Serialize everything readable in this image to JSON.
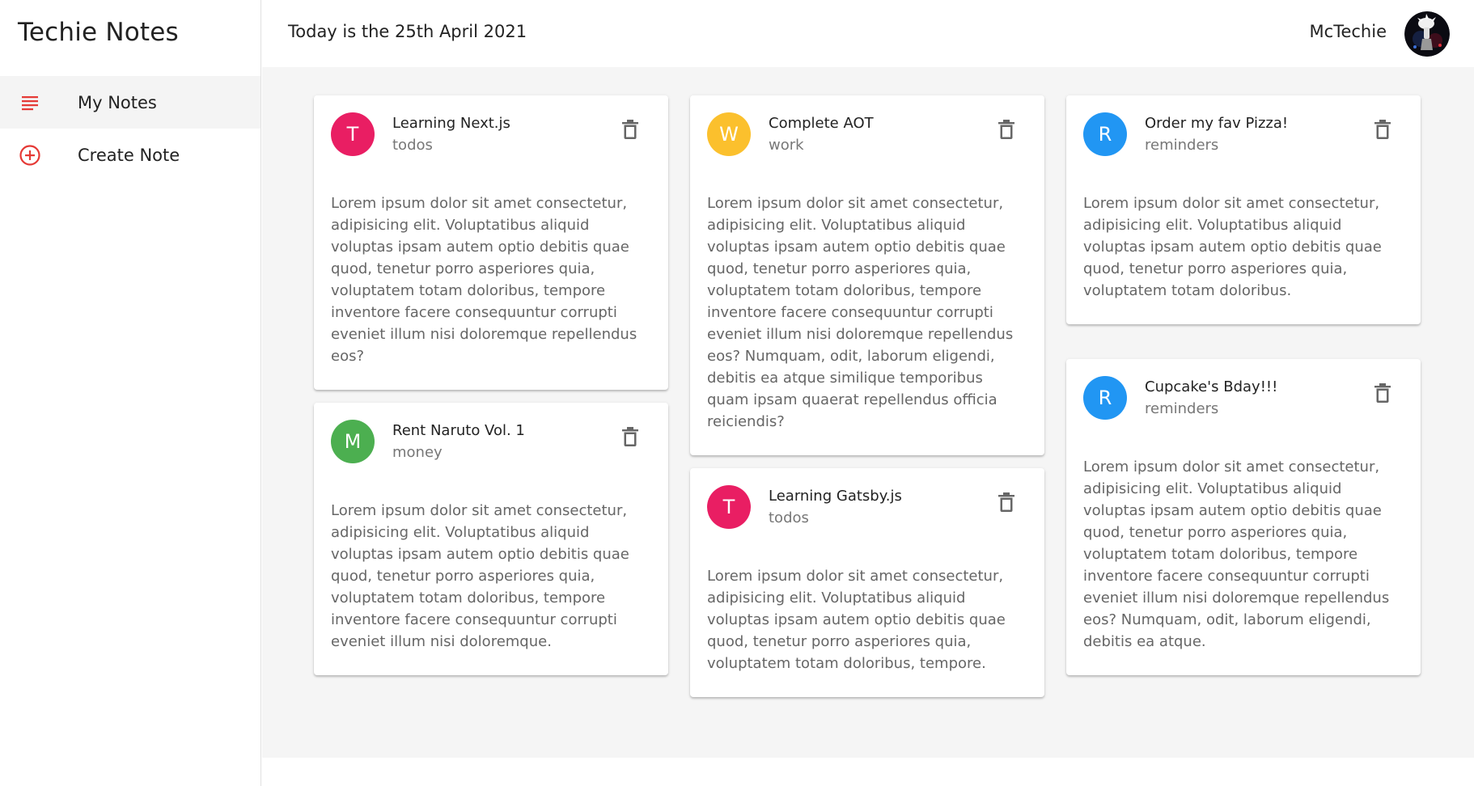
{
  "app": {
    "title": "Techie Notes"
  },
  "sidebar": {
    "items": [
      {
        "label": "My Notes",
        "icon": "subject-icon",
        "active": true
      },
      {
        "label": "Create Note",
        "icon": "add-circle-icon",
        "active": false
      }
    ]
  },
  "header": {
    "date_text": "Today is the 25th April 2021",
    "username": "McTechie"
  },
  "colors": {
    "accent": "#e53935",
    "todos": "#e91e63",
    "work": "#fbc02d",
    "money": "#4caf50",
    "reminders": "#2196f3"
  },
  "notes": [
    {
      "initial": "T",
      "title": "Learning Next.js",
      "category": "todos",
      "body": "Lorem ipsum dolor sit amet consectetur, adipisicing elit. Voluptatibus aliquid voluptas ipsam autem optio debitis quae quod, tenetur porro asperiores quia, voluptatem totam doloribus, tempore inventore facere consequuntur corrupti eveniet illum nisi doloremque repellendus eos?"
    },
    {
      "initial": "M",
      "title": "Rent Naruto Vol. 1",
      "category": "money",
      "body": "Lorem ipsum dolor sit amet consectetur, adipisicing elit. Voluptatibus aliquid voluptas ipsam autem optio debitis quae quod, tenetur porro asperiores quia, voluptatem totam doloribus, tempore inventore facere consequuntur corrupti eveniet illum nisi doloremque."
    },
    {
      "initial": "W",
      "title": "Complete AOT",
      "category": "work",
      "body": "Lorem ipsum dolor sit amet consectetur, adipisicing elit. Voluptatibus aliquid voluptas ipsam autem optio debitis quae quod, tenetur porro asperiores quia, voluptatem totam doloribus, tempore inventore facere consequuntur corrupti eveniet illum nisi doloremque repellendus eos? Numquam, odit, laborum eligendi, debitis ea atque similique temporibus quam ipsam quaerat repellendus officia reiciendis?"
    },
    {
      "initial": "T",
      "title": "Learning Gatsby.js",
      "category": "todos",
      "body": "Lorem ipsum dolor sit amet consectetur, adipisicing elit. Voluptatibus aliquid voluptas ipsam autem optio debitis quae quod, tenetur porro asperiores quia, voluptatem totam doloribus, tempore."
    },
    {
      "initial": "R",
      "title": "Order my fav Pizza!",
      "category": "reminders",
      "body": "Lorem ipsum dolor sit amet consectetur, adipisicing elit. Voluptatibus aliquid voluptas ipsam autem optio debitis quae quod, tenetur porro asperiores quia, voluptatem totam doloribus."
    },
    {
      "initial": "R",
      "title": "Cupcake's Bday!!!",
      "category": "reminders",
      "body": "Lorem ipsum dolor sit amet consectetur, adipisicing elit. Voluptatibus aliquid voluptas ipsam autem optio debitis quae quod, tenetur porro asperiores quia, voluptatem totam doloribus, tempore inventore facere consequuntur corrupti eveniet illum nisi doloremque repellendus eos? Numquam, odit, laborum eligendi, debitis ea atque."
    }
  ]
}
